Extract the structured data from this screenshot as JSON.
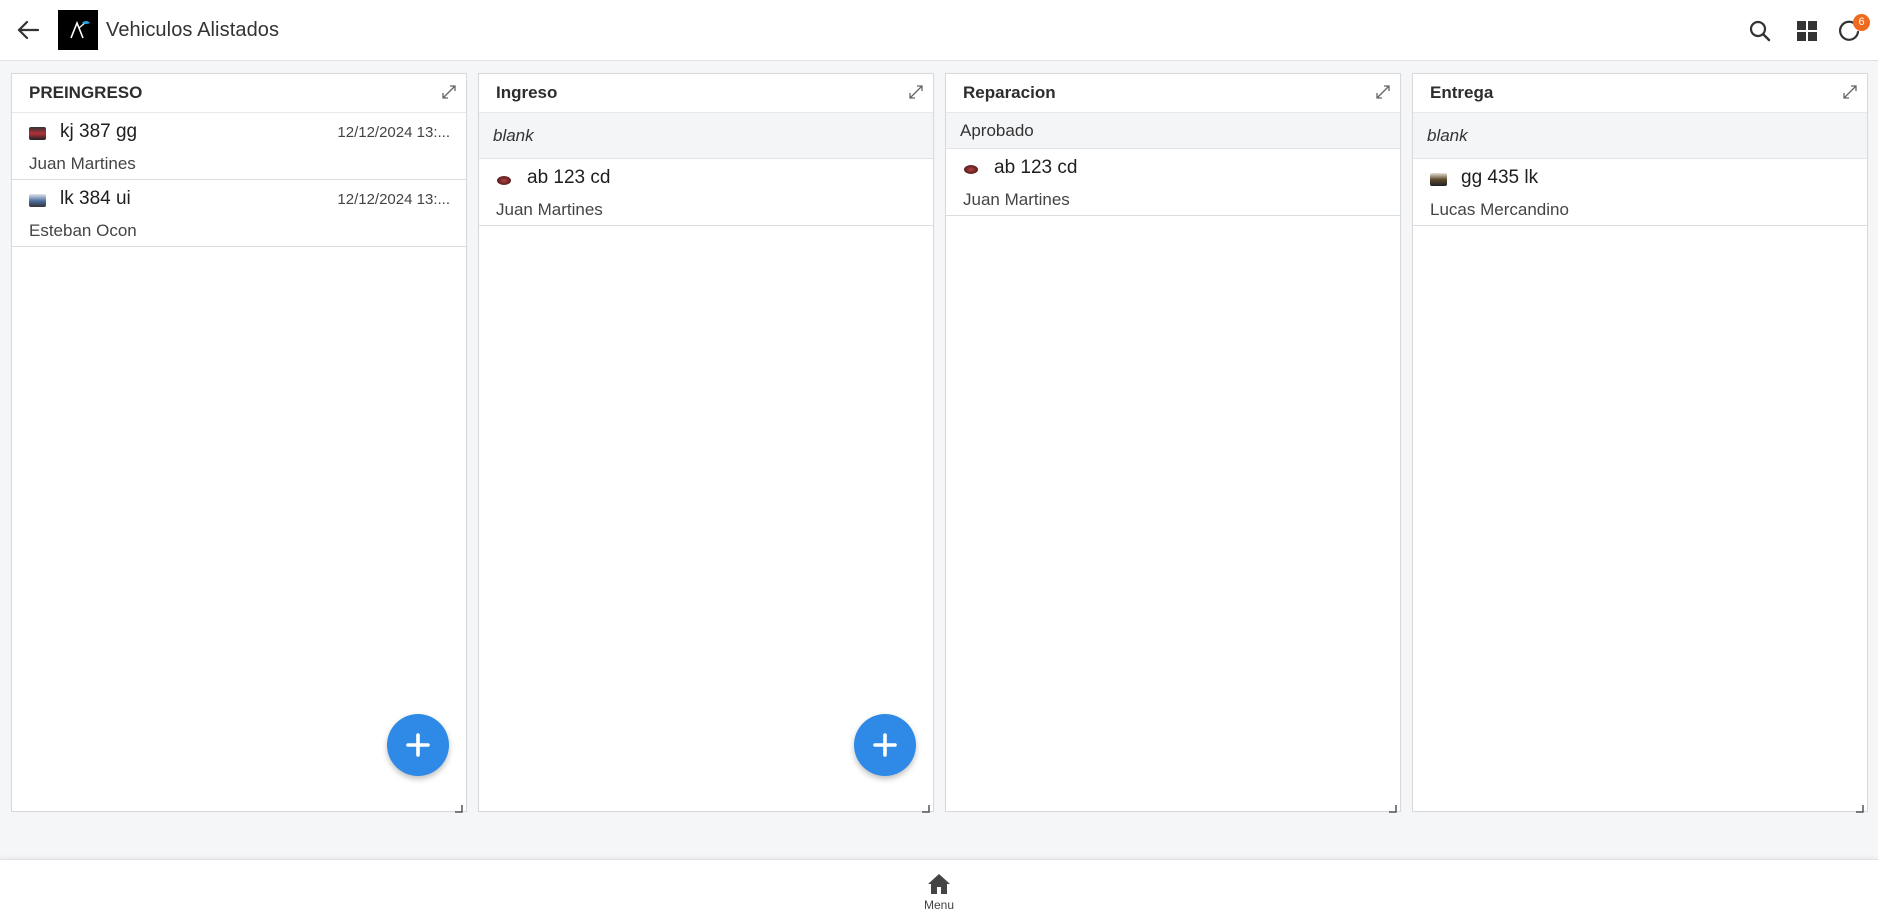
{
  "header": {
    "title": "Vehiculos Alistados",
    "notification_count": "6",
    "icons": [
      "back-arrow-icon",
      "search-icon",
      "grid-view-icon",
      "refresh-icon"
    ]
  },
  "columns": [
    {
      "title": "PREINGRESO",
      "groups": [],
      "cards": [
        {
          "plate": "kj 387 gg",
          "date": "12/12/2024 13:...",
          "owner": "Juan Martines",
          "thumb_color": "#b0323a"
        },
        {
          "plate": "lk 384 ui",
          "date": "12/12/2024 13:...",
          "owner": "Esteban Ocon",
          "thumb_color": "#4a6c9c"
        }
      ]
    },
    {
      "title": "Ingreso",
      "group_label": "blank",
      "cards": [
        {
          "plate": "ab 123 cd",
          "owner": "Juan Martines",
          "thumb_color": "#8a2a2a"
        }
      ]
    },
    {
      "title": "Reparacion",
      "group_label": "Aprobado",
      "cards": [
        {
          "plate": "ab 123 cd",
          "owner": "Juan Martines",
          "thumb_color": "#8a2a2a"
        }
      ]
    },
    {
      "title": "Entrega",
      "group_label": "blank",
      "cards": [
        {
          "plate": "gg 435 lk",
          "owner": "Lucas Mercandino",
          "thumb_color": "#5d4a2e"
        }
      ]
    }
  ],
  "bottom_nav": {
    "menu_label": "Menu"
  },
  "colors": {
    "accent": "#2e8ae6",
    "badge": "#f06a1d"
  }
}
